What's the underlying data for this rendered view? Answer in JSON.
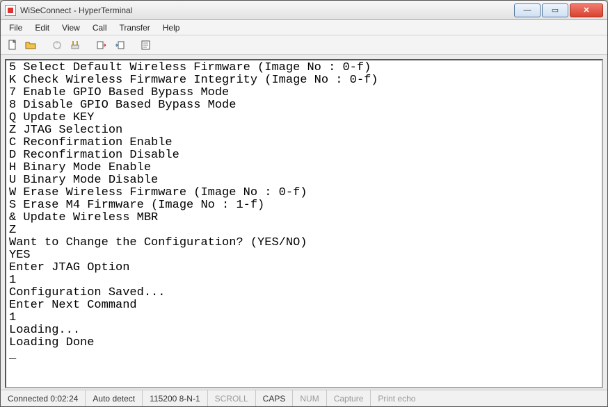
{
  "title": "WiSeConnect - HyperTerminal",
  "menu": [
    "File",
    "Edit",
    "View",
    "Call",
    "Transfer",
    "Help"
  ],
  "toolbar_icons": [
    "new-file",
    "open-file",
    "connect",
    "disconnect",
    "send",
    "receive",
    "properties"
  ],
  "terminal_lines": [
    "5 Select Default Wireless Firmware (Image No : 0-f)",
    "K Check Wireless Firmware Integrity (Image No : 0-f)",
    "7 Enable GPIO Based Bypass Mode",
    "8 Disable GPIO Based Bypass Mode",
    "Q Update KEY",
    "Z JTAG Selection",
    "C Reconfirmation Enable",
    "D Reconfirmation Disable",
    "H Binary Mode Enable",
    "U Binary Mode Disable",
    "W Erase Wireless Firmware (Image No : 0-f)",
    "S Erase M4 Firmware (Image No : 1-f)",
    "& Update Wireless MBR",
    "Z",
    "Want to Change the Configuration? (YES/NO)",
    "YES",
    "Enter JTAG Option",
    "1",
    "Configuration Saved...",
    "Enter Next Command",
    "1",
    "Loading...",
    "Loading Done"
  ],
  "cursor": "_",
  "status": {
    "connected": "Connected 0:02:24",
    "detect": "Auto detect",
    "baud": "115200 8-N-1",
    "scroll": "SCROLL",
    "caps": "CAPS",
    "num": "NUM",
    "capture": "Capture",
    "printecho": "Print echo"
  },
  "winbtns": {
    "min": "—",
    "max": "▭",
    "close": "✕"
  }
}
